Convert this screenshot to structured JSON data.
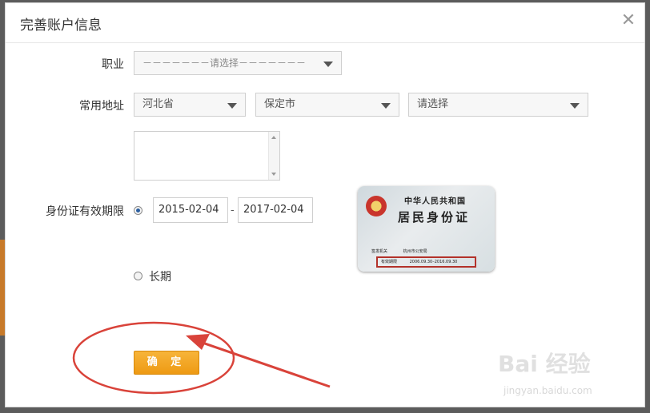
{
  "dialog": {
    "title": "完善账户信息",
    "close_icon": "close-icon"
  },
  "form": {
    "occupation": {
      "label": "职业",
      "selected": "－－－－－－－请选择－－－－－－－"
    },
    "address": {
      "label": "常用地址",
      "province": "河北省",
      "city": "保定市",
      "district": "请选择",
      "detail_value": ""
    },
    "id_validity": {
      "label": "身份证有效期限",
      "start_date": "2015-02-04",
      "separator": "-",
      "end_date": "2017-02-04",
      "option_range_selected": true,
      "long_term_label": "长期"
    },
    "confirm_label": "确 定"
  },
  "id_card": {
    "country": "中华人民共和国",
    "title": "居民身份证",
    "authority_label": "签发机关",
    "authority_value": "杭州市公安局",
    "validity_label": "有效期限",
    "validity_value": "2006.09.30–2016.09.30"
  },
  "watermark": {
    "brand": "Bai 经验",
    "url": "jingyan.baidu.com"
  },
  "colors": {
    "accent": "#f0a01c",
    "annotation": "#d9433a"
  }
}
